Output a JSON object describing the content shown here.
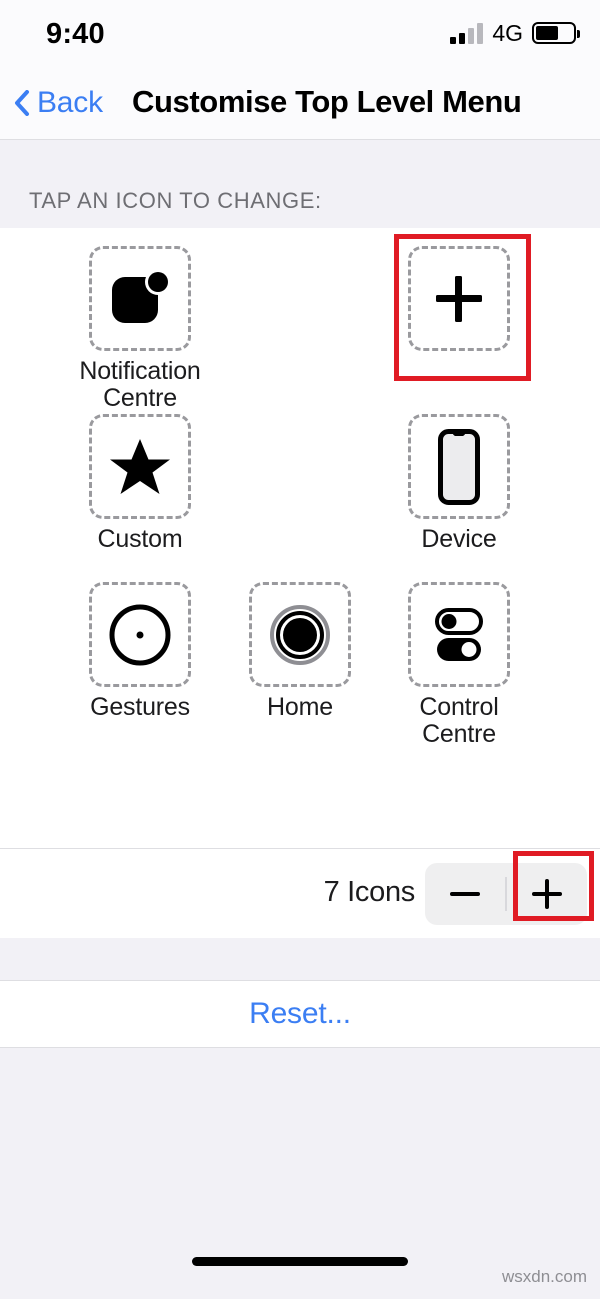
{
  "status_bar": {
    "time": "9:40",
    "network": "4G",
    "signal_icon": "cellular-signal-icon",
    "battery_icon": "battery-icon"
  },
  "nav": {
    "back_label": "Back",
    "back_icon": "chevron-left-icon",
    "title": "Customise Top Level Menu"
  },
  "section": {
    "header": "TAP AN ICON TO CHANGE:"
  },
  "grid": {
    "items": [
      {
        "label": "Notification\nCentre",
        "icon": "notification-centre-icon",
        "highlighted": false
      },
      {
        "label": "",
        "icon": "add-icon",
        "highlighted": true
      },
      {
        "label": "Custom",
        "icon": "star-icon",
        "highlighted": false
      },
      {
        "label": "Device",
        "icon": "device-phone-icon",
        "highlighted": false
      },
      {
        "label": "Gestures",
        "icon": "gestures-circle-icon",
        "highlighted": false
      },
      {
        "label": "Home",
        "icon": "home-circle-icon",
        "highlighted": false
      },
      {
        "label": "Control\nCentre",
        "icon": "control-centre-toggles-icon",
        "highlighted": false
      }
    ]
  },
  "stepper": {
    "count_label": "7 Icons",
    "minus_icon": "minus-icon",
    "plus_icon": "plus-icon"
  },
  "reset": {
    "label": "Reset..."
  },
  "footer": {
    "watermark": "wsxdn.com",
    "home_indicator": "home-indicator"
  },
  "colors": {
    "accent_blue": "#3b7ef3",
    "highlight_red": "#e01b24",
    "group_background": "#f2f1f6"
  }
}
